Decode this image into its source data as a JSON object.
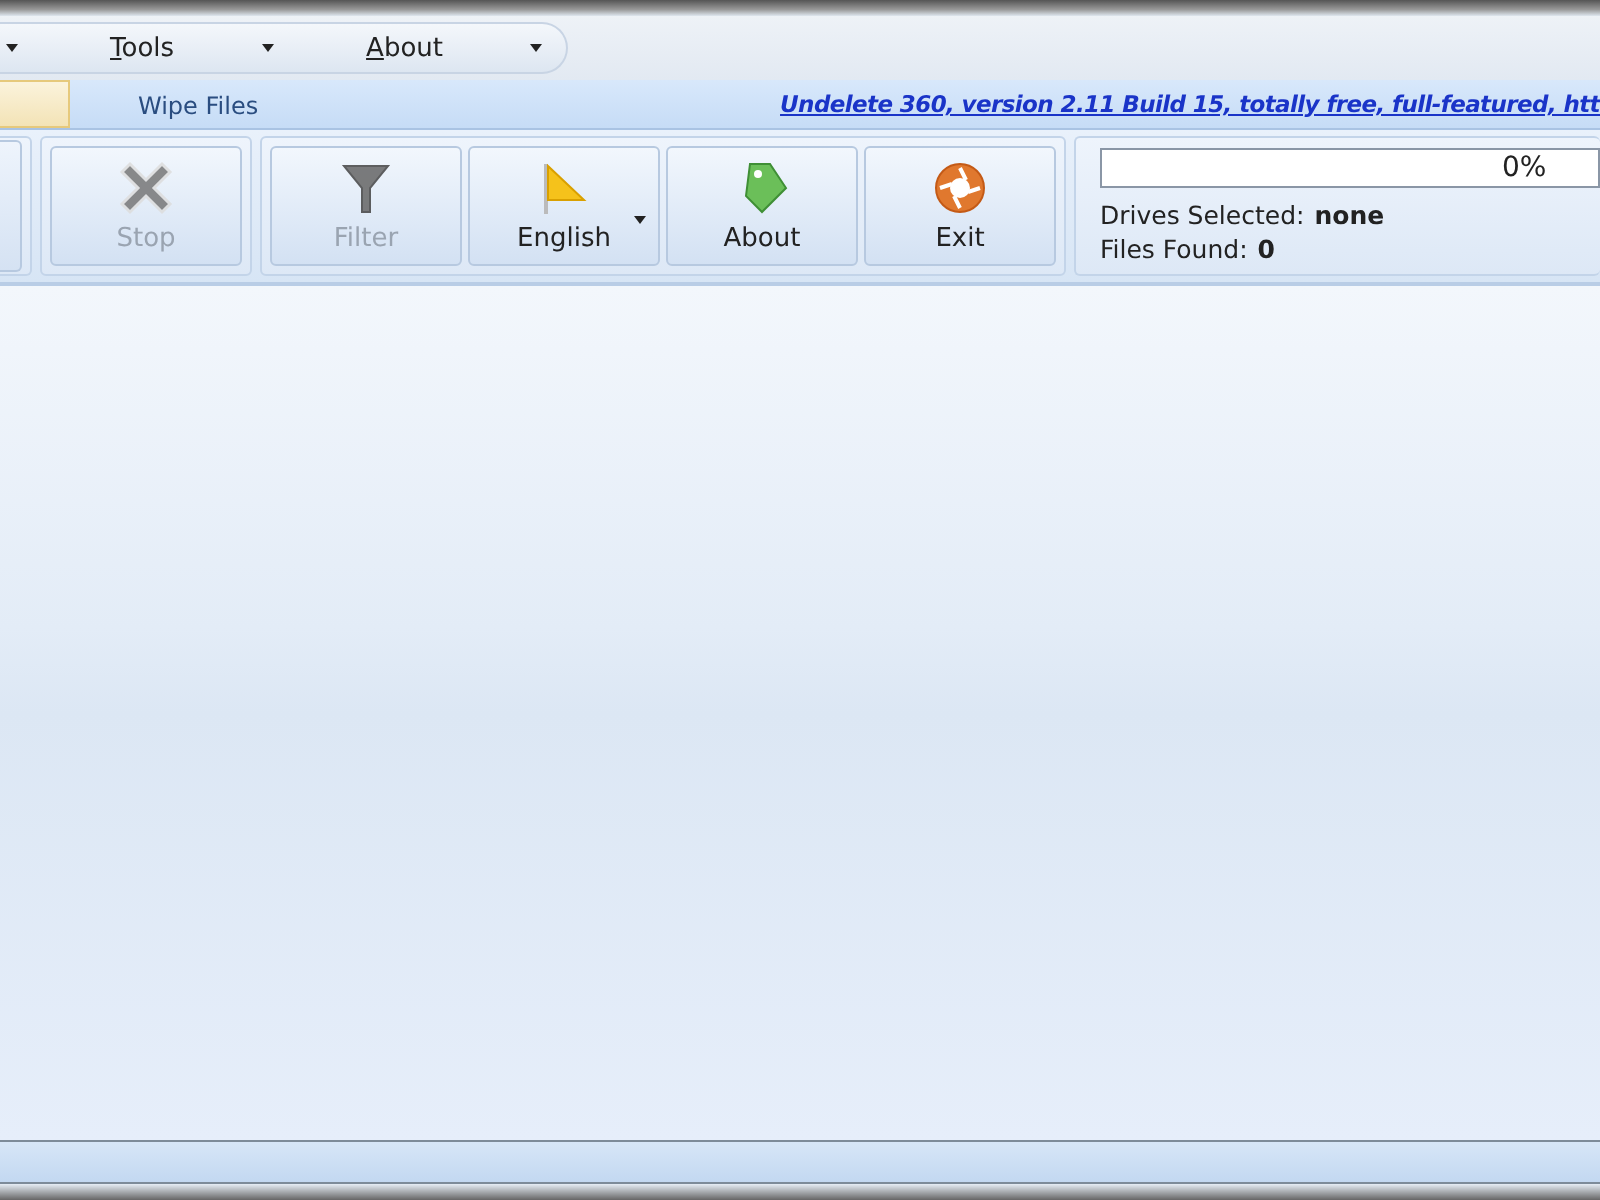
{
  "menu": [
    {
      "label": "Tools"
    },
    {
      "label": "About"
    }
  ],
  "tabs": [
    {
      "selected": true
    },
    {
      "label": "Wipe Files",
      "selected": false
    }
  ],
  "banner_link": "Undelete 360, version 2.11 Build 15, totally free, full-featured, htt",
  "toolbar_groups": [
    {
      "buttons": [
        {
          "kind": "stop",
          "label": "Stop",
          "disabled": true
        }
      ]
    },
    {
      "buttons": [
        {
          "kind": "filter",
          "label": "Filter",
          "disabled": true
        },
        {
          "kind": "language",
          "label": "English",
          "disabled": false,
          "dropdown": true
        },
        {
          "kind": "about",
          "label": "About",
          "disabled": false
        },
        {
          "kind": "exit",
          "label": "Exit",
          "disabled": false
        }
      ]
    }
  ],
  "progress": {
    "level": 0,
    "reading": "0%"
  },
  "status": [
    {
      "label": "Drives Selected:",
      "value": "none"
    },
    {
      "label": "Files Found:",
      "value": "0"
    }
  ]
}
